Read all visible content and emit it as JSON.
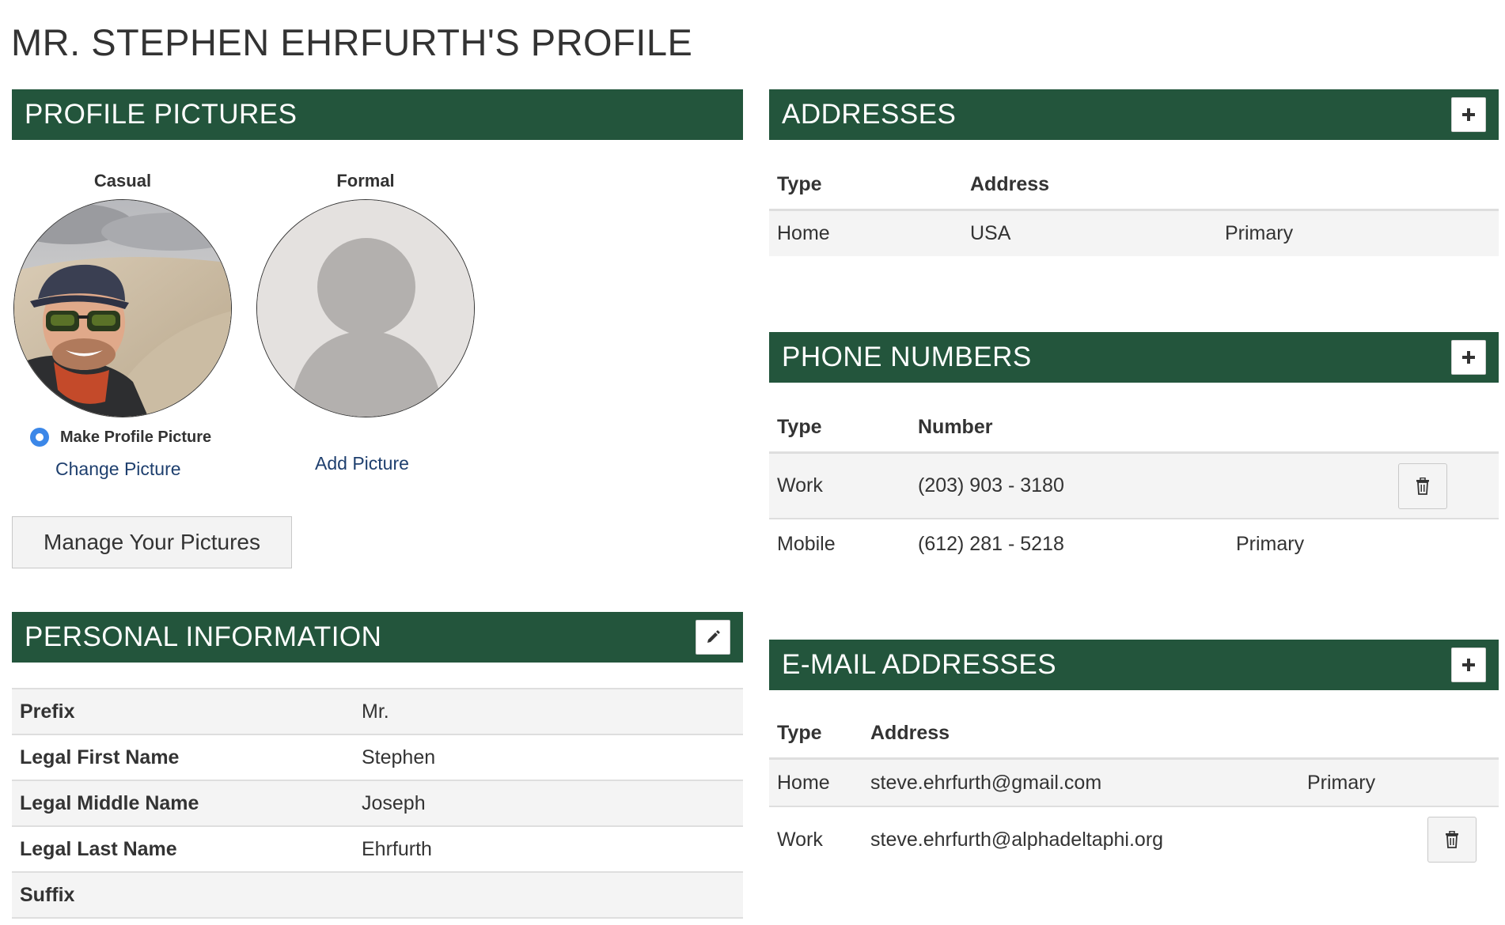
{
  "page_title": "MR. STEPHEN EHRFURTH'S PROFILE",
  "profile_pictures": {
    "header": "PROFILE PICTURES",
    "casual": {
      "label": "Casual",
      "make_profile_label": "Make Profile Picture",
      "change_link": "Change Picture"
    },
    "formal": {
      "label": "Formal",
      "add_link": "Add Picture"
    },
    "manage_button": "Manage Your Pictures"
  },
  "personal_information": {
    "header": "PERSONAL INFORMATION",
    "rows": [
      {
        "key": "Prefix",
        "value": "Mr."
      },
      {
        "key": "Legal First Name",
        "value": "Stephen"
      },
      {
        "key": "Legal Middle Name",
        "value": "Joseph"
      },
      {
        "key": "Legal Last Name",
        "value": "Ehrfurth"
      },
      {
        "key": "Suffix",
        "value": ""
      }
    ]
  },
  "addresses": {
    "header": "ADDRESSES",
    "columns": [
      "Type",
      "Address"
    ],
    "rows": [
      {
        "type": "Home",
        "address": "USA",
        "status": "Primary"
      }
    ]
  },
  "phone_numbers": {
    "header": "PHONE NUMBERS",
    "columns": [
      "Type",
      "Number"
    ],
    "rows": [
      {
        "type": "Work",
        "number": "(203) 903 - 3180",
        "status": ""
      },
      {
        "type": "Mobile",
        "number": "(612) 281 - 5218",
        "status": "Primary"
      }
    ]
  },
  "email_addresses": {
    "header": "E-MAIL ADDRESSES",
    "columns": [
      "Type",
      "Address"
    ],
    "rows": [
      {
        "type": "Home",
        "address": "steve.ehrfurth@gmail.com",
        "status": "Primary"
      },
      {
        "type": "Work",
        "address": "steve.ehrfurth@alphadeltaphi.org",
        "status": ""
      }
    ]
  },
  "colors": {
    "header_green": "#23553C",
    "link_blue": "#1e3f6e",
    "radio_blue": "#3b87e8"
  },
  "icons": {
    "add": "plus-icon",
    "edit": "pencil-icon",
    "delete": "trash-icon"
  }
}
